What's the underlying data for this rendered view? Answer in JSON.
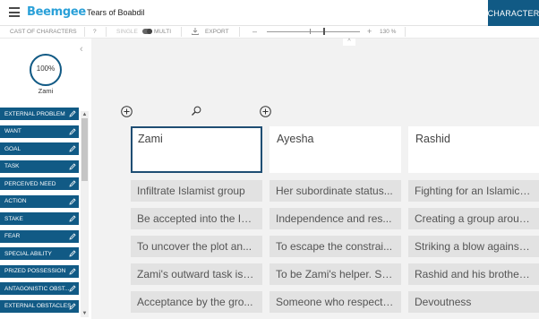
{
  "app": {
    "brand": "Beemgee",
    "doc_title": "Tears of Boabdil",
    "mode_button": "CHARACTER"
  },
  "toolbar": {
    "cast": "CAST OF CHARACTERS",
    "help": "?",
    "single": "SINGLE",
    "multi": "MULTI",
    "export": "EXPORT",
    "zoom_minus": "–",
    "zoom_plus": "+",
    "zoom_level": "130 %",
    "zoom_fraction": 0.62
  },
  "character": {
    "progress": "100%",
    "progress_fraction": 1.0,
    "name": "Zami"
  },
  "categories": [
    "EXTERNAL PROBLEM",
    "WANT",
    "GOAL",
    "TASK",
    "PERCEIVED NEED",
    "ACTION",
    "STAKE",
    "FEAR",
    "SPECIAL ABILITY",
    "PRIZED POSSESSION",
    "ANTAGONISTIC OBST...",
    "EXTERNAL OBSTACLES"
  ],
  "columns": [
    {
      "name": "Zami",
      "cells": [
        "Infiltrate Islamist group",
        "Be accepted into the Isl...",
        "To uncover the plot an...",
        "Zami's outward task is t...",
        "Acceptance by the gro..."
      ]
    },
    {
      "name": "Ayesha",
      "cells": [
        "Her subordinate status...",
        "Independence and res...",
        "To escape the constrai...",
        "To be Zami's helper. Sh...",
        "Someone who respects..."
      ]
    },
    {
      "name": "Rashid",
      "cells": [
        "Fighting for an Islamic s...",
        "Creating a group aroun...",
        "Striking a blow against ...",
        "Rashid and his brother ...",
        "Devoutness"
      ]
    }
  ],
  "colors": {
    "brand": "#2aa0d8",
    "accent": "#115a85",
    "active_border": "#1f4e73"
  }
}
